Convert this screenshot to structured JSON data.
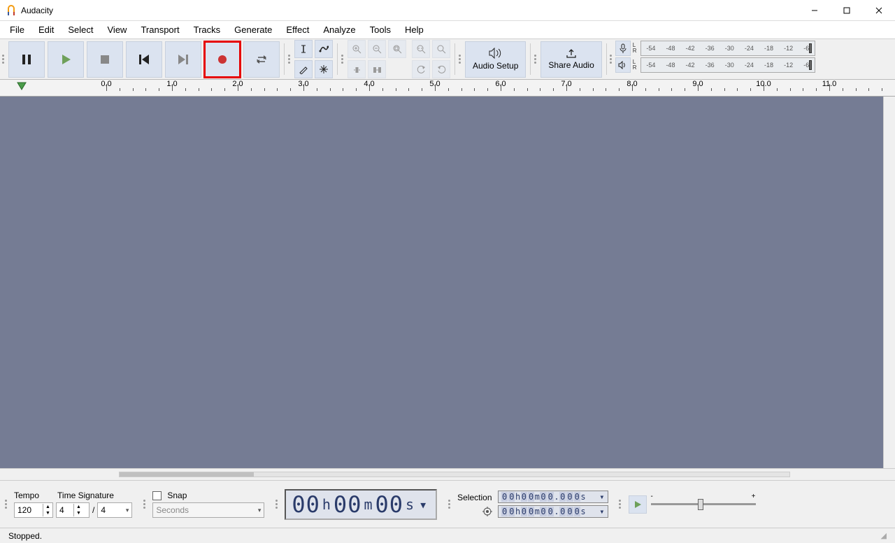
{
  "titlebar": {
    "title": "Audacity"
  },
  "menu": [
    "File",
    "Edit",
    "Select",
    "View",
    "Transport",
    "Tracks",
    "Generate",
    "Effect",
    "Analyze",
    "Tools",
    "Help"
  ],
  "transport": {
    "buttons": [
      "pause",
      "play",
      "stop",
      "skip-start",
      "skip-end",
      "record",
      "loop"
    ]
  },
  "audio_setup_label": "Audio Setup",
  "share_audio_label": "Share Audio",
  "meter_ticks": [
    "-54",
    "-48",
    "-42",
    "-36",
    "-30",
    "-24",
    "-18",
    "-12",
    "-6"
  ],
  "timeline_major": [
    "0.0",
    "1.0",
    "2.0",
    "3.0",
    "4.0",
    "5.0",
    "6.0",
    "7.0",
    "8.0",
    "9.0",
    "10.0",
    "11.0"
  ],
  "bottom": {
    "tempo_label": "Tempo",
    "tempo_value": "120",
    "tsig_label": "Time Signature",
    "tsig_num": "4",
    "tsig_den": "4",
    "snap_label": "Snap",
    "snap_unit": "Seconds",
    "counter": {
      "h": "00",
      "m": "00",
      "s": "00"
    },
    "selection_label": "Selection",
    "sel_start": "00h00m00.000s",
    "sel_end": "00h00m00.000s",
    "speed_minus": "-",
    "speed_plus": "+"
  },
  "status": "Stopped."
}
